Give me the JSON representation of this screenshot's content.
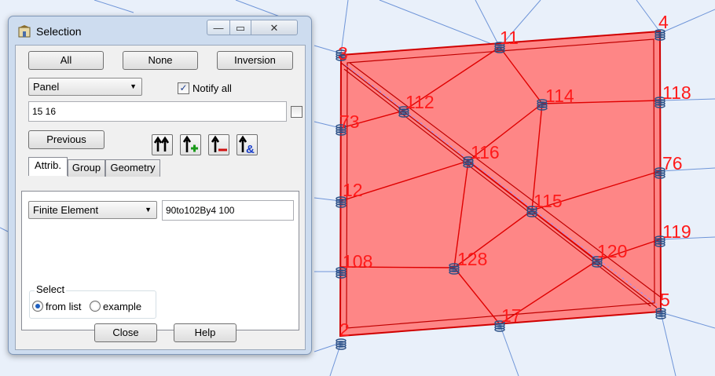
{
  "window": {
    "title": "Selection",
    "minimize_glyph": "—",
    "maximize_glyph": "▭",
    "close_glyph": "✕"
  },
  "buttons": {
    "all": "All",
    "none": "None",
    "inversion": "Inversion",
    "previous": "Previous",
    "close": "Close",
    "help": "Help"
  },
  "entity_type": {
    "selected": "Panel"
  },
  "notify_all": {
    "label": "Notify all",
    "checked": true
  },
  "selection_input": {
    "value": "15 16"
  },
  "toolbar": {
    "icons": [
      "select-up-icon",
      "add-selection-icon",
      "remove-selection-icon",
      "intersect-selection-icon"
    ]
  },
  "tabs": [
    {
      "label": "Attrib.",
      "active": true
    },
    {
      "label": "Group",
      "active": false
    },
    {
      "label": "Geometry",
      "active": false
    }
  ],
  "attrib": {
    "property": "Finite Element",
    "value": "90to102By4 100"
  },
  "select_group": {
    "title": "Select",
    "options": [
      "from list",
      "example"
    ],
    "selected": "from list"
  },
  "model": {
    "panel_fill": "#ff8080",
    "line_color": "#e00000",
    "label_color": "#ff1a1a",
    "nodes": [
      {
        "id": "2",
        "label": "2"
      },
      {
        "id": "3",
        "label": "3"
      },
      {
        "id": "4",
        "label": "4"
      },
      {
        "id": "5",
        "label": "5"
      },
      {
        "id": "11",
        "label": "11"
      },
      {
        "id": "12",
        "label": "12"
      },
      {
        "id": "17",
        "label": "17"
      },
      {
        "id": "73",
        "label": "73"
      },
      {
        "id": "76",
        "label": "76"
      },
      {
        "id": "108",
        "label": "108"
      },
      {
        "id": "112",
        "label": "112"
      },
      {
        "id": "114",
        "label": "114"
      },
      {
        "id": "115",
        "label": "115"
      },
      {
        "id": "116",
        "label": "116"
      },
      {
        "id": "118",
        "label": "118"
      },
      {
        "id": "119",
        "label": "119"
      },
      {
        "id": "120",
        "label": "120"
      },
      {
        "id": "128",
        "label": "128"
      }
    ]
  }
}
